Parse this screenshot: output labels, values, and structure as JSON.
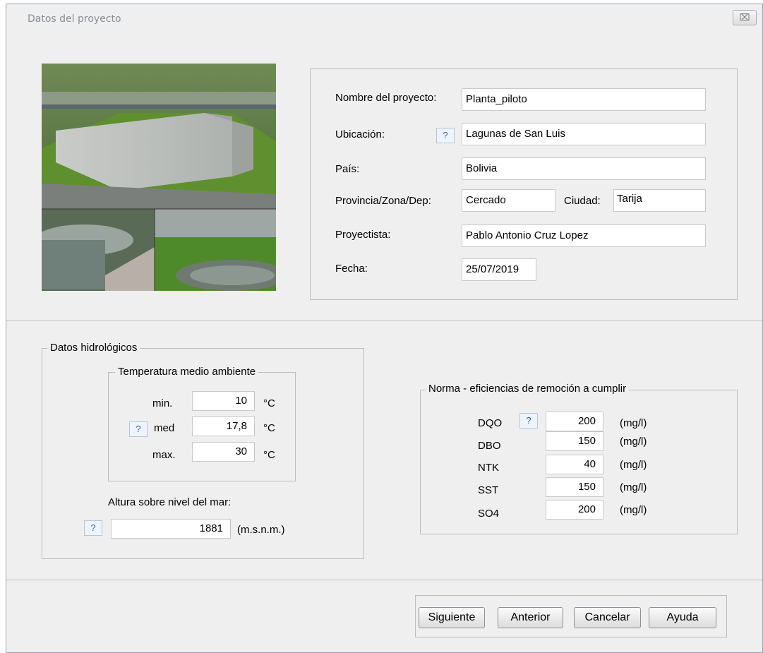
{
  "window": {
    "title": "Datos del proyecto",
    "close_glyph": "⌧"
  },
  "project": {
    "name_label": "Nombre del proyecto:",
    "name_value": "Planta_piloto",
    "location_label": "Ubicación:",
    "location_value": "Lagunas de San Luis",
    "country_label": "País:",
    "country_value": "Bolivia",
    "province_label": "Provincia/Zona/Dep:",
    "province_value": "Cercado",
    "city_label": "Ciudad:",
    "city_value": "Tarija",
    "designer_label": "Proyectista:",
    "designer_value": "Pablo Antonio Cruz Lopez",
    "date_label": "Fecha:",
    "date_value": "25/07/2019"
  },
  "help_label": "?",
  "hydro": {
    "group_label": "Datos hidrológicos",
    "temp_group_label": "Temperatura medio ambiente",
    "min_label": "min.",
    "min_value": "10",
    "med_label": "med",
    "med_value": "17,8",
    "max_label": "max.",
    "max_value": "30",
    "unit_celsius": "°C",
    "altitude_label": "Altura sobre nivel del mar:",
    "altitude_value": "1881",
    "altitude_unit": "(m.s.n.m.)"
  },
  "norma": {
    "group_label": "Norma - eficiencias de remoción a cumplir",
    "unit": "(mg/l)",
    "rows": [
      {
        "label": "DQO",
        "value": "200"
      },
      {
        "label": "DBO",
        "value": "150"
      },
      {
        "label": "NTK",
        "value": "40"
      },
      {
        "label": "SST",
        "value": "150"
      },
      {
        "label": "SO4",
        "value": "200"
      }
    ]
  },
  "buttons": {
    "next": "Siguiente",
    "prev": "Anterior",
    "cancel": "Cancelar",
    "help": "Ayuda"
  },
  "colors": {
    "window_bg": "#efefef",
    "help_text": "#2a66b0",
    "border": "#b9bcc0"
  }
}
